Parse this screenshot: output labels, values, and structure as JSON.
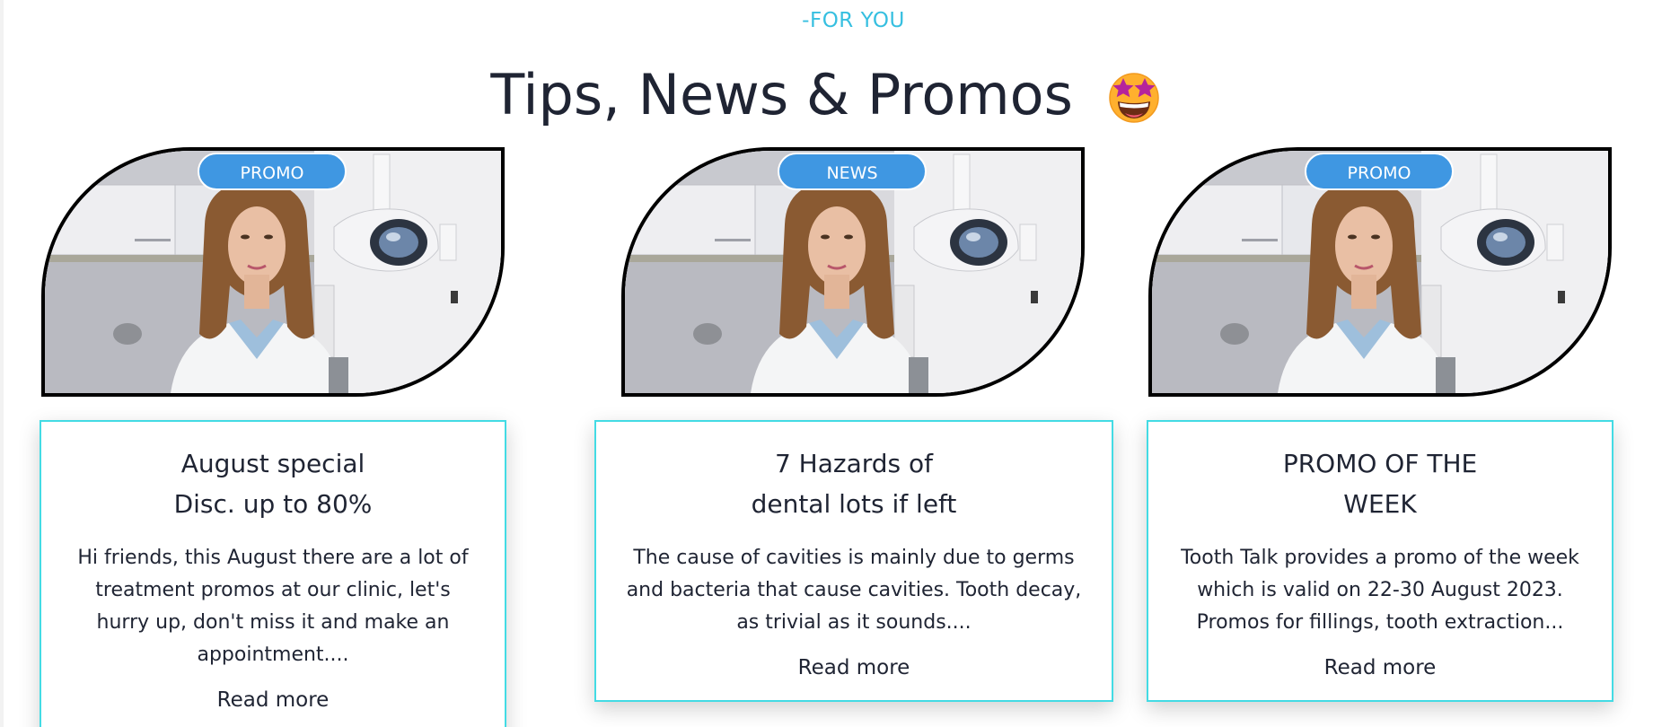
{
  "section": {
    "eyebrow": "-FOR YOU",
    "heading": "Tips, News & Promos",
    "heading_emoji": "star-struck-emoji"
  },
  "cards": [
    {
      "badge": "PROMO",
      "title": "August special\nDisc. up to 80%",
      "text": "Hi friends, this August there are a lot of treatment promos at our clinic, let's hurry up, don't miss it and make an appointment....",
      "link": "Read more"
    },
    {
      "badge": "NEWS",
      "title": "7 Hazards of\ndental lots if left",
      "text": "The cause of cavities is mainly due to germs and bacteria that cause cavities. Tooth decay, as trivial as it sounds....",
      "link": "Read more"
    },
    {
      "badge": "PROMO",
      "title": "PROMO OF THE\nWEEK",
      "text": "Tooth Talk provides a promo of the week which is valid on 22-30 August 2023. Promos for fillings, tooth extraction...",
      "link": "Read more"
    }
  ],
  "colors": {
    "accent": "#36bfe0",
    "badge": "#3f97e2",
    "card_border": "#43dbe4",
    "text": "#1f2433"
  }
}
